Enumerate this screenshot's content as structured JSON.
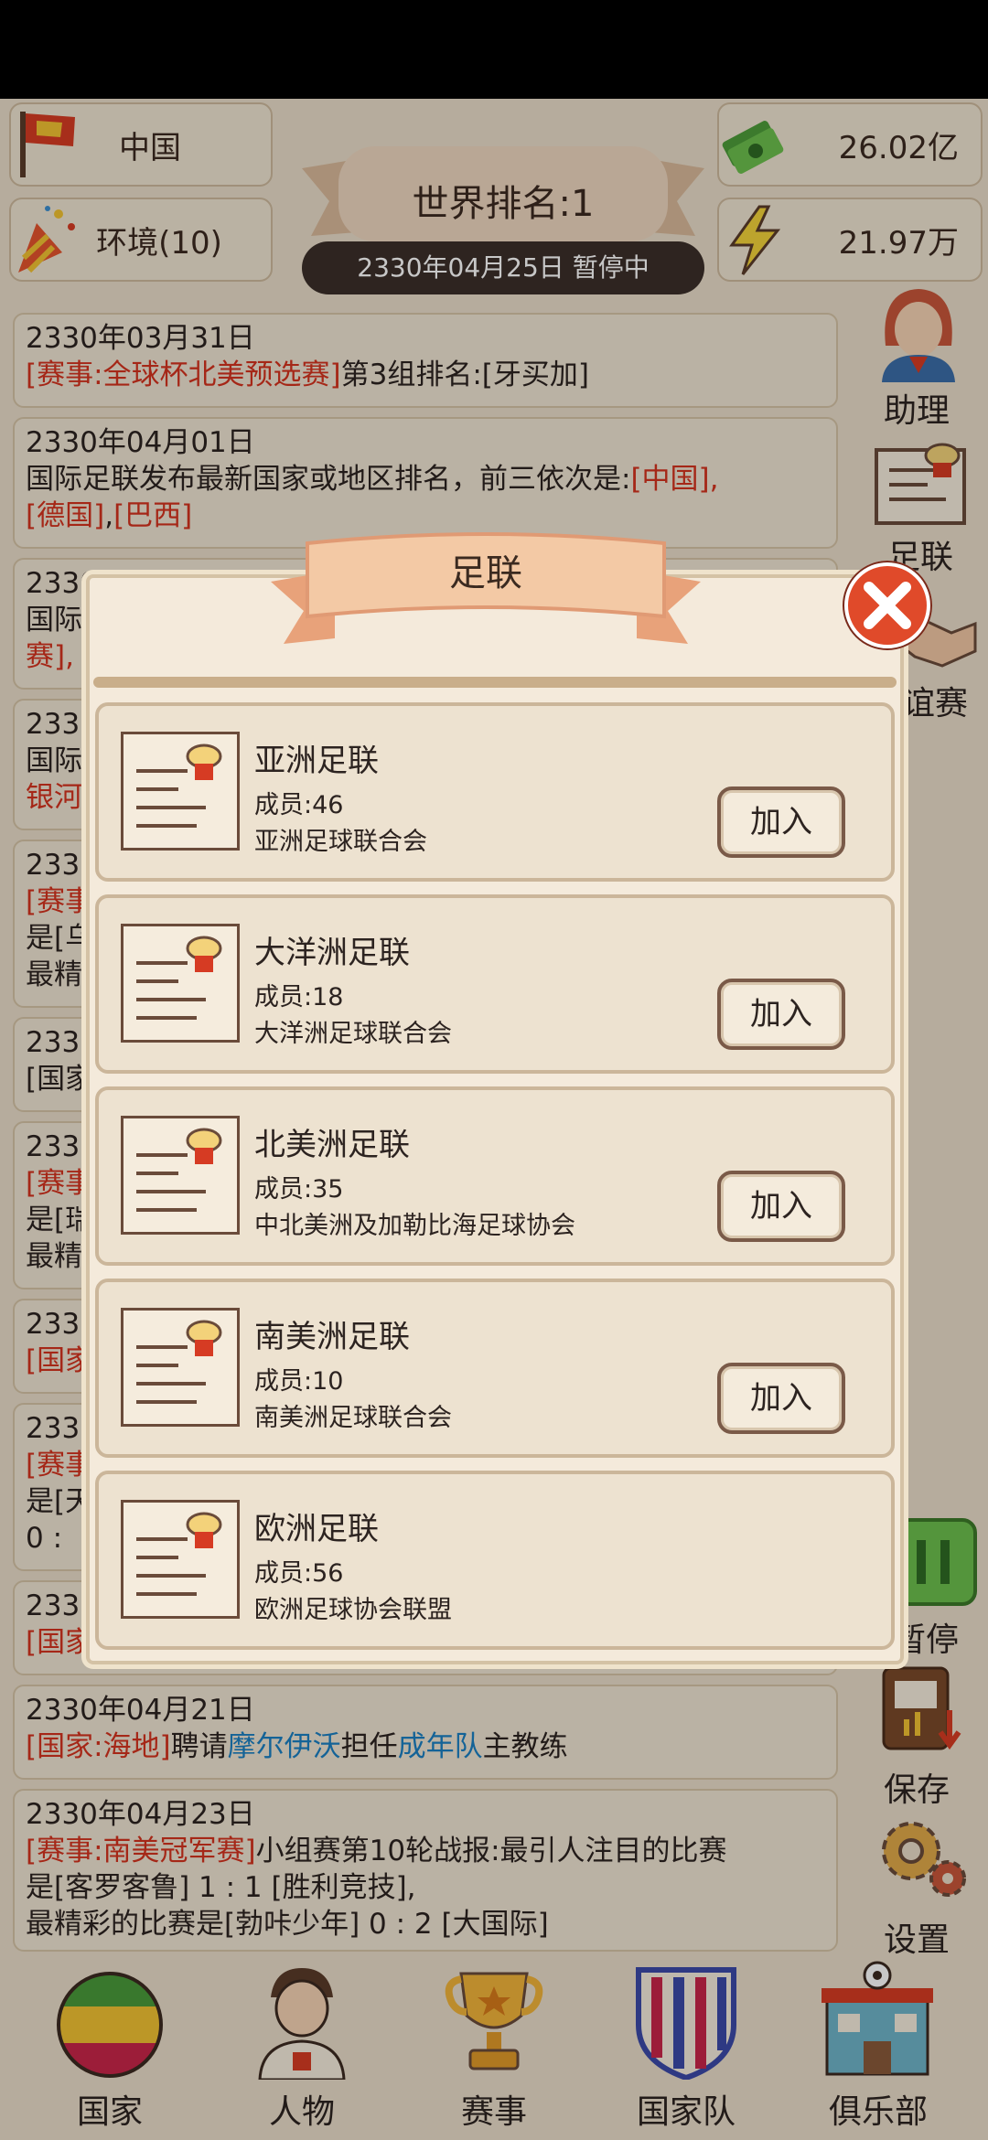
{
  "topbar": {
    "country": "中国",
    "environment": "环境(10)",
    "world_rank": "世界排名:1",
    "date_status": "2330年04月25日  暂停中",
    "money": "26.02亿",
    "energy": "21.97万"
  },
  "news": [
    {
      "date": "2330年03月31日",
      "l1a": "[赛事:全球杯北美预选赛]",
      "l1b": "第3组排名:[牙买加]"
    },
    {
      "date": "2330年04月01日",
      "l1": "国际足联发布最新国家或地区排名，前三依次是:",
      "l1r": "[中国],",
      "l2a": "[德国]",
      "l2b": ",",
      "l2c": "[巴西]"
    },
    {
      "date": "2330",
      "l1": "国际",
      "l2": "赛],"
    },
    {
      "date": "2330",
      "l1": "国际",
      "l2": "银河"
    },
    {
      "date": "2330",
      "l1": "[赛事",
      "l2": "是[乌",
      "l3": "最精"
    },
    {
      "date": "2330",
      "l1": "[国家"
    },
    {
      "date": "2330",
      "l1": "[赛事",
      "l2": "是[瑞",
      "l3": "最精"
    },
    {
      "date": "2330",
      "l1": "[国家"
    },
    {
      "date": "2330",
      "l1": "[赛事",
      "l2": "是[天",
      "l3": "0 :"
    },
    {
      "date": "2330",
      "l1": "[国家"
    },
    {
      "date": "2330年04月21日",
      "a": "[国家:海地]",
      "b": "聘请",
      "c": "摩尔伊沃",
      "d": "担任",
      "e": "成年队",
      "f": "主教练"
    },
    {
      "date": "2330年04月23日",
      "l1a": "[赛事:南美冠军赛]",
      "l1b": "小组赛第10轮战报:最引人注目的比赛",
      "l2": "是[客罗客鲁]  1 : 1 [胜利竞技],",
      "l3": "最精彩的比赛是[勃咔少年]  0 : 2 [大国际]"
    }
  ],
  "side": {
    "assistant": "助理",
    "fifa": "足联",
    "friendly": "谊赛",
    "pause": "暂停",
    "save": "保存",
    "settings": "设置"
  },
  "nav": {
    "country": "国家",
    "people": "人物",
    "events": "赛事",
    "national_team": "国家队",
    "club": "俱乐部"
  },
  "modal": {
    "title": "足联",
    "join_label": "加入",
    "confeds": [
      {
        "name": "亚洲足联",
        "members": "成员:46",
        "desc": "亚洲足球联合会"
      },
      {
        "name": "大洋洲足联",
        "members": "成员:18",
        "desc": "大洋洲足球联合会"
      },
      {
        "name": "北美洲足联",
        "members": "成员:35",
        "desc": "中北美洲及加勒比海足球协会"
      },
      {
        "name": "南美洲足联",
        "members": "成员:10",
        "desc": "南美洲足球联合会"
      },
      {
        "name": "欧洲足联",
        "members": "成员:56",
        "desc": "欧洲足球协会联盟"
      }
    ]
  },
  "colors": {
    "accent_red": "#d4321e",
    "link_blue": "#1a7fc2",
    "panel": "#efe4d3",
    "close_red": "#e04a2a"
  }
}
